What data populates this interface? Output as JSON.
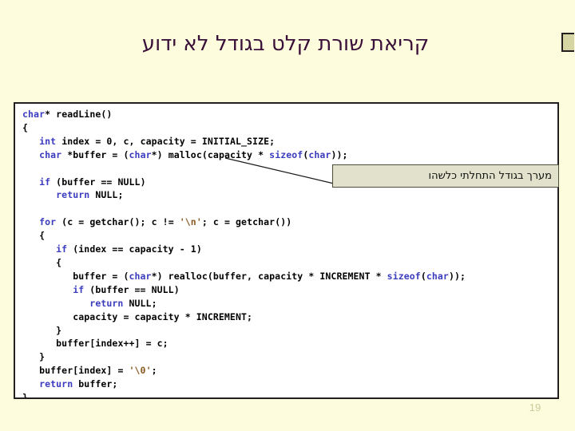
{
  "slide": {
    "background_color": "#fdfcdd",
    "title": "קריאת שורת קלט בגודל לא ידוע",
    "title_color": "#3a1039",
    "page_number": "19"
  },
  "corner_mark": {
    "name": "corner-decoration",
    "fill_color": "#d6d5a4",
    "border_color": "#231f20"
  },
  "code_block": {
    "background_color": "#ffffff",
    "border_color": "#231f20",
    "language": "c",
    "keyword_color": "#3b3bbf",
    "string_color": "#8a5a22",
    "plain_color": "#000000",
    "lines": [
      "char* readLine()",
      "{",
      "   int index = 0, c, capacity = INITIAL_SIZE;",
      "   char *buffer = (char*) malloc(capacity * sizeof(char));",
      "",
      "   if (buffer == NULL)",
      "      return NULL;",
      "",
      "   for (c = getchar(); c != '\\n'; c = getchar())",
      "   {",
      "      if (index == capacity - 1)",
      "      {",
      "         buffer = (char*) realloc(buffer, capacity * INCREMENT * sizeof(char));",
      "         if (buffer == NULL)",
      "            return NULL;",
      "         capacity = capacity * INCREMENT;",
      "      }",
      "      buffer[index++] = c;",
      "   }",
      "   buffer[index] = '\\0';",
      "   return buffer;",
      "}"
    ]
  },
  "callout": {
    "text": "מערך בגודל התחלתי כלשהו",
    "fill_color": "#e2e1cb",
    "border_color": "#4d4d3c",
    "leader_line_color": "#1a1a1a"
  }
}
